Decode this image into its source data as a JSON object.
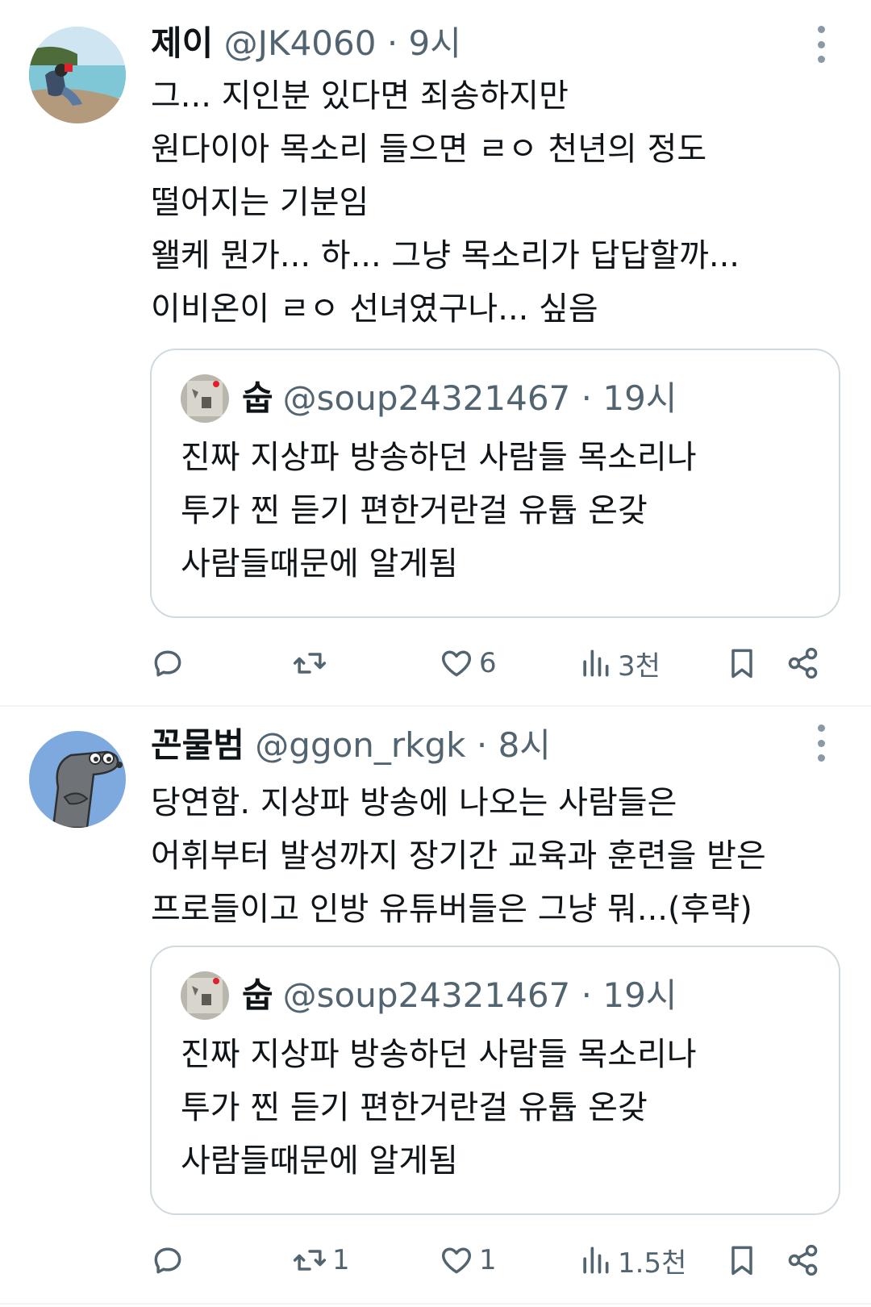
{
  "tweets": [
    {
      "name": "제이",
      "handle": "@JK4060",
      "dot": "·",
      "time": "9시",
      "lines": [
        "그... 지인분 있다면 죄송하지만",
        "원다이아 목소리 들으면 ㄹㅇ 천년의 정도",
        "떨어지는 기분임",
        "왤케 뭔가... 하... 그냥 목소리가 답답할까...",
        "이비온이 ㄹㅇ 선녀였구나... 싶음"
      ],
      "quote": {
        "name": "숩",
        "handle": "@soup24321467",
        "dot": "·",
        "time": "19시",
        "lines": [
          "진짜 지상파 방송하던 사람들 목소리나",
          "투가 찐 듣기 편한거란걸 유튭 온갖",
          "사람들때문에 알게됨"
        ]
      },
      "actions": {
        "reply": "",
        "retweet": "",
        "like": "6",
        "views": "3천"
      }
    },
    {
      "name": "꼰물범",
      "handle": "@ggon_rkgk",
      "dot": "·",
      "time": "8시",
      "lines": [
        "당연함. 지상파 방송에 나오는 사람들은",
        "어휘부터 발성까지 장기간 교육과 훈련을 받은",
        "프로들이고 인방 유튜버들은 그냥 뭐...(후략)"
      ],
      "quote": {
        "name": "숩",
        "handle": "@soup24321467",
        "dot": "·",
        "time": "19시",
        "lines": [
          "진짜 지상파 방송하던 사람들 목소리나",
          "투가 찐 듣기 편한거란걸 유튭 온갖",
          "사람들때문에 알게됨"
        ]
      },
      "actions": {
        "reply": "",
        "retweet": "1",
        "like": "1",
        "views": "1.5천"
      }
    }
  ],
  "icons": {
    "reply": "reply-icon",
    "retweet": "retweet-icon",
    "like": "heart-icon",
    "views": "views-icon",
    "bookmark": "bookmark-icon",
    "share": "share-icon",
    "more": "more-options-icon"
  },
  "colors": {
    "text": "#0f1419",
    "secondary": "#536471",
    "border": "#cfd9de",
    "divider": "#eff3f4"
  }
}
